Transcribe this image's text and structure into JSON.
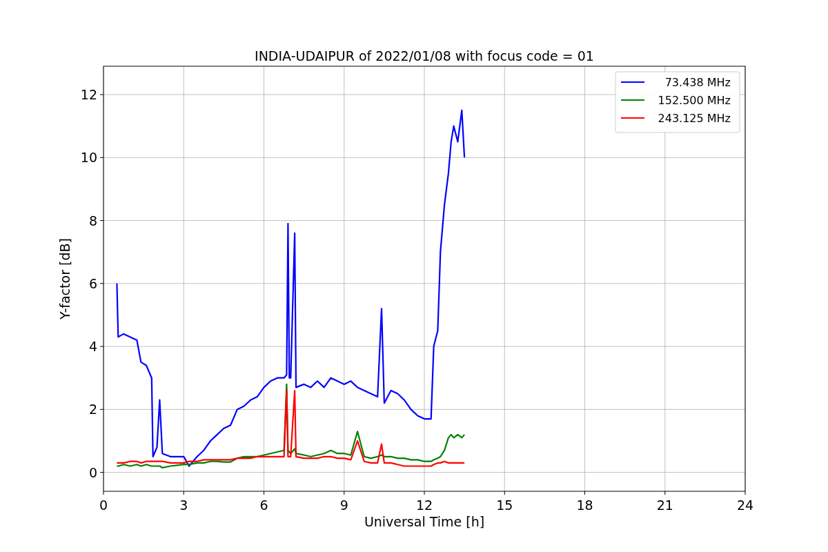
{
  "chart_data": {
    "type": "line",
    "title": "INDIA-UDAIPUR of 2022/01/08 with focus code = 01",
    "xlabel": "Universal Time [h]",
    "ylabel": "Y-factor [dB]",
    "grid": true,
    "legend": true,
    "xlim": [
      0,
      24
    ],
    "ylim": [
      -0.6,
      12.9
    ],
    "xticks": [
      0,
      3,
      6,
      9,
      12,
      15,
      18,
      21,
      24
    ],
    "yticks": [
      0,
      2,
      4,
      6,
      8,
      10,
      12
    ],
    "x": [
      0.5,
      0.55,
      0.75,
      1.0,
      1.25,
      1.4,
      1.6,
      1.8,
      1.85,
      2.0,
      2.1,
      2.2,
      2.5,
      3.0,
      3.2,
      3.5,
      3.75,
      4.0,
      4.25,
      4.5,
      4.75,
      5.0,
      5.25,
      5.5,
      5.75,
      6.0,
      6.25,
      6.5,
      6.75,
      6.85,
      6.9,
      6.95,
      7.0,
      7.15,
      7.2,
      7.5,
      7.75,
      8.0,
      8.25,
      8.5,
      8.75,
      9.0,
      9.25,
      9.5,
      9.75,
      10.0,
      10.25,
      10.4,
      10.5,
      10.75,
      11.0,
      11.25,
      11.5,
      11.75,
      12.0,
      12.25,
      12.35,
      12.5,
      12.6,
      12.75,
      12.9,
      13.0,
      13.1,
      13.25,
      13.4,
      13.5
    ],
    "series": [
      {
        "name": "73.438 MHz",
        "color": "#0000ff",
        "values": [
          6.0,
          4.3,
          4.4,
          4.3,
          4.2,
          3.5,
          3.4,
          3.0,
          0.5,
          0.8,
          2.3,
          0.6,
          0.5,
          0.5,
          0.2,
          0.5,
          0.7,
          1.0,
          1.2,
          1.4,
          1.5,
          2.0,
          2.1,
          2.3,
          2.4,
          2.7,
          2.9,
          3.0,
          3.0,
          3.1,
          7.9,
          3.0,
          3.0,
          7.6,
          2.7,
          2.8,
          2.7,
          2.9,
          2.7,
          3.0,
          2.9,
          2.8,
          2.9,
          2.7,
          2.6,
          2.5,
          2.4,
          5.2,
          2.2,
          2.6,
          2.5,
          2.3,
          2.0,
          1.8,
          1.7,
          1.7,
          4.0,
          4.5,
          7.0,
          8.5,
          9.5,
          10.5,
          11.0,
          10.5,
          11.5,
          10.0
        ]
      },
      {
        "name": "152.500 MHz",
        "color": "#008000",
        "values": [
          0.2,
          0.2,
          0.25,
          0.2,
          0.25,
          0.2,
          0.25,
          0.2,
          0.2,
          0.2,
          0.2,
          0.15,
          0.2,
          0.25,
          0.25,
          0.3,
          0.3,
          0.35,
          0.35,
          0.33,
          0.33,
          0.45,
          0.5,
          0.5,
          0.5,
          0.55,
          0.6,
          0.65,
          0.7,
          2.8,
          0.7,
          0.65,
          0.6,
          0.75,
          0.6,
          0.55,
          0.5,
          0.55,
          0.6,
          0.7,
          0.6,
          0.6,
          0.55,
          1.3,
          0.5,
          0.45,
          0.5,
          0.55,
          0.5,
          0.5,
          0.45,
          0.45,
          0.4,
          0.4,
          0.35,
          0.35,
          0.4,
          0.45,
          0.5,
          0.7,
          1.1,
          1.2,
          1.1,
          1.2,
          1.1,
          1.2
        ]
      },
      {
        "name": "243.125 MHz",
        "color": "#ff0000",
        "values": [
          0.3,
          0.3,
          0.3,
          0.35,
          0.35,
          0.3,
          0.35,
          0.35,
          0.35,
          0.35,
          0.35,
          0.35,
          0.3,
          0.3,
          0.35,
          0.35,
          0.4,
          0.4,
          0.4,
          0.4,
          0.4,
          0.45,
          0.45,
          0.45,
          0.5,
          0.5,
          0.5,
          0.5,
          0.5,
          2.6,
          0.5,
          0.5,
          0.5,
          2.6,
          0.5,
          0.45,
          0.45,
          0.45,
          0.5,
          0.5,
          0.45,
          0.45,
          0.4,
          1.0,
          0.35,
          0.3,
          0.3,
          0.9,
          0.3,
          0.3,
          0.25,
          0.2,
          0.2,
          0.2,
          0.2,
          0.2,
          0.25,
          0.3,
          0.3,
          0.35,
          0.3,
          0.3,
          0.3,
          0.3,
          0.3,
          0.3
        ]
      }
    ]
  }
}
